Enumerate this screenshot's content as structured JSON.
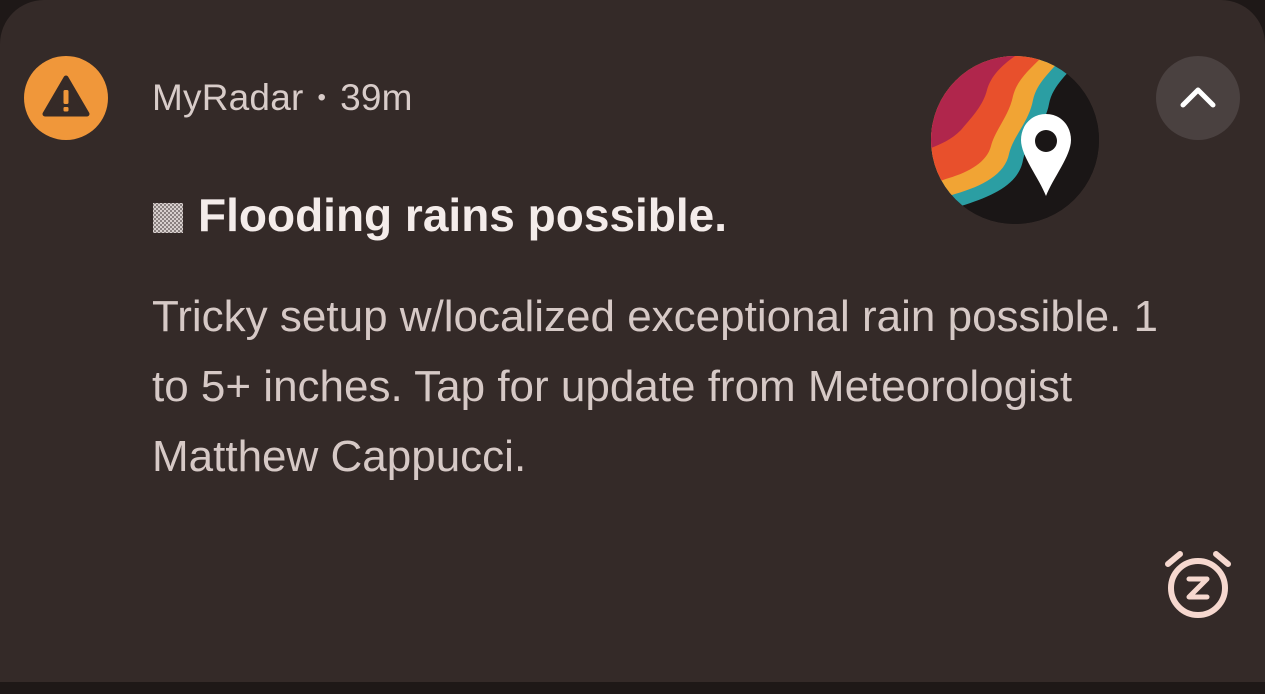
{
  "notification": {
    "app_name": "MyRadar",
    "separator": "•",
    "time_ago": "39m",
    "title": "Flooding rains possible.",
    "body": "Tricky setup w/localized exceptional rain possible. 1 to 5+ inches. Tap for update from Meteorologist Matthew Cappucci.",
    "icons": {
      "app": "warning-triangle-icon",
      "title_prefix": "rain-pattern-icon",
      "collapse": "chevron-up-icon",
      "snooze": "snooze-alarm-icon",
      "thumbnail": "myradar-logo"
    },
    "colors": {
      "background": "#342a28",
      "app_icon": "#f0973a",
      "title_text": "#f4ecea",
      "body_text": "#d6c9c6",
      "snooze_icon": "#f6d8cf"
    }
  }
}
